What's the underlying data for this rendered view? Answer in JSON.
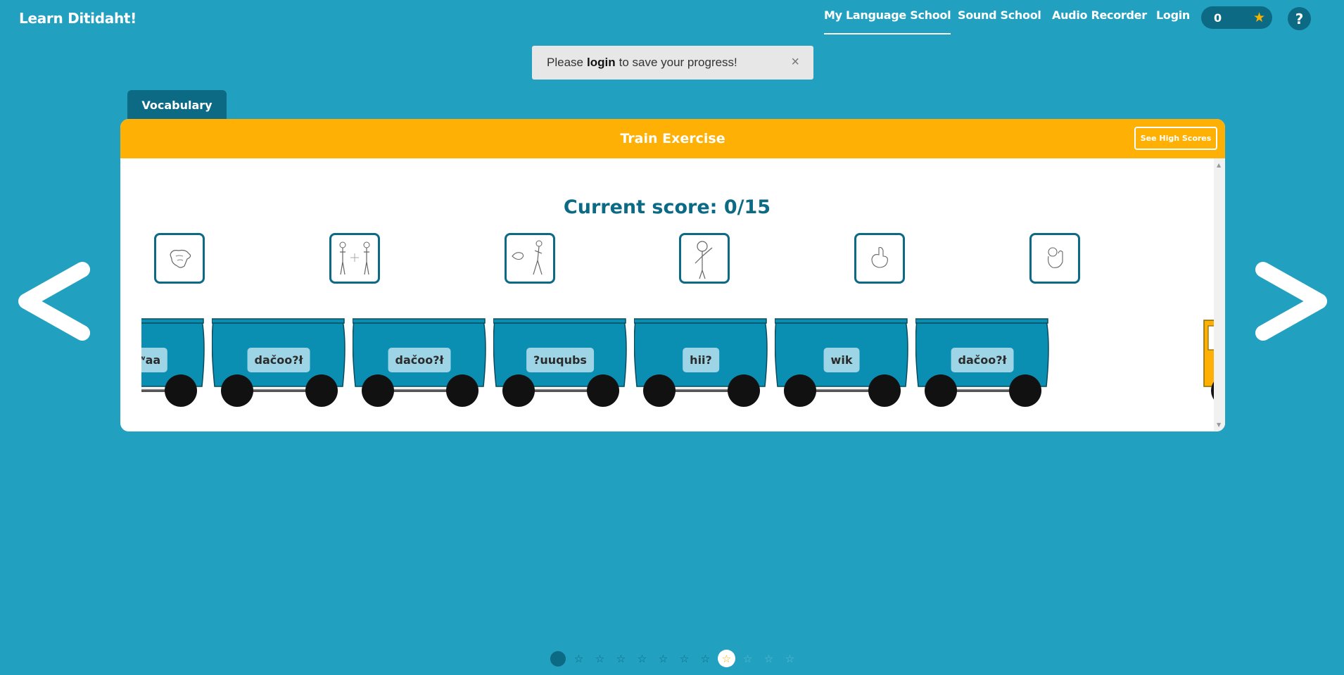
{
  "header": {
    "brand": "Learn Ditidaht!",
    "nav": [
      "My Language School",
      "Sound School",
      "Audio Recorder",
      "Login"
    ],
    "active_nav": "My Language School",
    "star_count": "0",
    "help_label": "?"
  },
  "toast": {
    "prefix": "Please",
    "link": "login",
    "suffix": "to save your progress!",
    "close_label": "×"
  },
  "tab_label": "Vocabulary",
  "exercise": {
    "title": "Train Exercise",
    "high_scores_label": "See High Scores",
    "score_text": "Current score: 0/15",
    "score_value": 0,
    "score_total": 15
  },
  "picture_cards": [
    {
      "icon": "fist-hand-icon"
    },
    {
      "icon": "two-people-icon"
    },
    {
      "icon": "hand-and-walking-man-icon"
    },
    {
      "icon": "man-pointing-head-icon"
    },
    {
      "icon": "thumb-gesture-icon"
    },
    {
      "icon": "ok-hand-icon"
    }
  ],
  "train_cars": [
    "yuqʷaa",
    "dačoo?ł",
    "dačoo?ł",
    "?uuqubs",
    "hii?",
    "wik",
    "dačoo?ł"
  ],
  "progress_dots": [
    "current",
    "done",
    "done",
    "done",
    "done",
    "done",
    "done",
    "done",
    "active",
    "locked",
    "locked",
    "locked"
  ],
  "colors": {
    "background": "#21a0c0",
    "dark_teal": "#0d6a85",
    "accent_orange": "#feb104",
    "car_blue": "#0a8fb3",
    "label_bg": "#9dd4e6"
  }
}
